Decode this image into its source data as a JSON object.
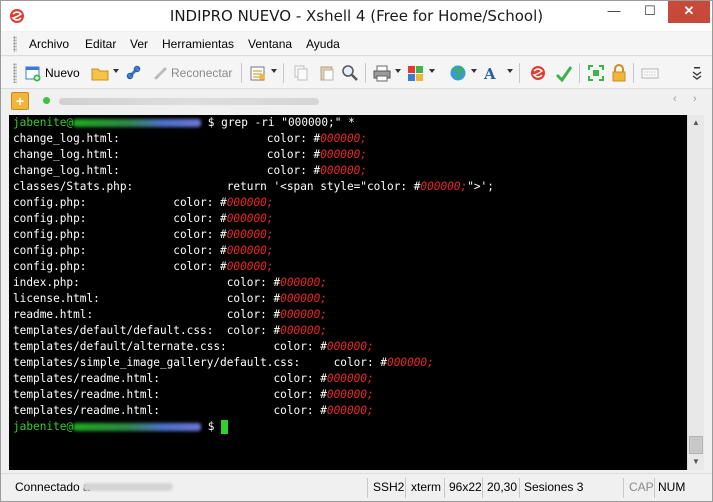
{
  "window": {
    "title": "INDIPRO NUEVO - Xshell 4 (Free for Home/School)",
    "min_glyph": "—",
    "max_glyph": "☐",
    "close_glyph": "✕"
  },
  "menu": [
    "Archivo",
    "Editar",
    "Ver",
    "Herramientas",
    "Ventana",
    "Ayuda"
  ],
  "toolbar": {
    "new_label": "Nuevo",
    "reconnect_label": "Reconectar",
    "icons": [
      "new-session-icon",
      "open-folder-icon",
      "link-icon",
      "reconnect-icon",
      "properties-icon",
      "copy-icon",
      "paste-icon",
      "find-icon",
      "print-icon",
      "color-scheme-icon",
      "globe-icon",
      "font-icon",
      "xftp-icon",
      "transfer-icon",
      "fullscreen-icon",
      "lock-icon",
      "keyboard-icon"
    ]
  },
  "terminal": {
    "prompt_user": "jabenite@",
    "prompt_suffix": " $ ",
    "command": "grep -ri \"000000;\" *",
    "lines": [
      {
        "pre": "change_log.html:                      color: #",
        "red": "000000;",
        "post": ""
      },
      {
        "pre": "change_log.html:                      color: #",
        "red": "000000;",
        "post": ""
      },
      {
        "pre": "change_log.html:                      color: #",
        "red": "000000;",
        "post": ""
      },
      {
        "pre": "classes/Stats.php:              return '<span style=\"color: #",
        "red": "000000;",
        "post": "\">';"
      },
      {
        "pre": "config.php:             color: #",
        "red": "000000;",
        "post": ""
      },
      {
        "pre": "config.php:             color: #",
        "red": "000000;",
        "post": ""
      },
      {
        "pre": "config.php:             color: #",
        "red": "000000;",
        "post": ""
      },
      {
        "pre": "config.php:             color: #",
        "red": "000000;",
        "post": ""
      },
      {
        "pre": "config.php:             color: #",
        "red": "000000;",
        "post": ""
      },
      {
        "pre": "index.php:                      color: #",
        "red": "000000;",
        "post": ""
      },
      {
        "pre": "license.html:                   color: #",
        "red": "000000;",
        "post": ""
      },
      {
        "pre": "readme.html:                    color: #",
        "red": "000000;",
        "post": ""
      },
      {
        "pre": "templates/default/default.css:  color: #",
        "red": "000000;",
        "post": ""
      },
      {
        "pre": "templates/default/alternate.css:       color: #",
        "red": "000000;",
        "post": ""
      },
      {
        "pre": "templates/simple_image_gallery/default.css:     color: #",
        "red": "000000;",
        "post": ""
      },
      {
        "pre": "templates/readme.html:                 color: #",
        "red": "000000;",
        "post": ""
      },
      {
        "pre": "templates/readme.html:                 color: #",
        "red": "000000;",
        "post": ""
      },
      {
        "pre": "templates/readme.html:                 color: #",
        "red": "000000;",
        "post": ""
      }
    ]
  },
  "status": {
    "connected": "Connectado a",
    "protocol": "SSH2",
    "term_type": "xterm",
    "size": "96x22",
    "cursor_pos": "20,30",
    "sessions": "Sesiones 3",
    "cap": "CAP",
    "num": "NUM"
  },
  "colors": {
    "terminal_bg": "#000000",
    "prompt_green": "#2fd12f",
    "match_red": "#e8242b",
    "close_button": "#c7493a"
  }
}
